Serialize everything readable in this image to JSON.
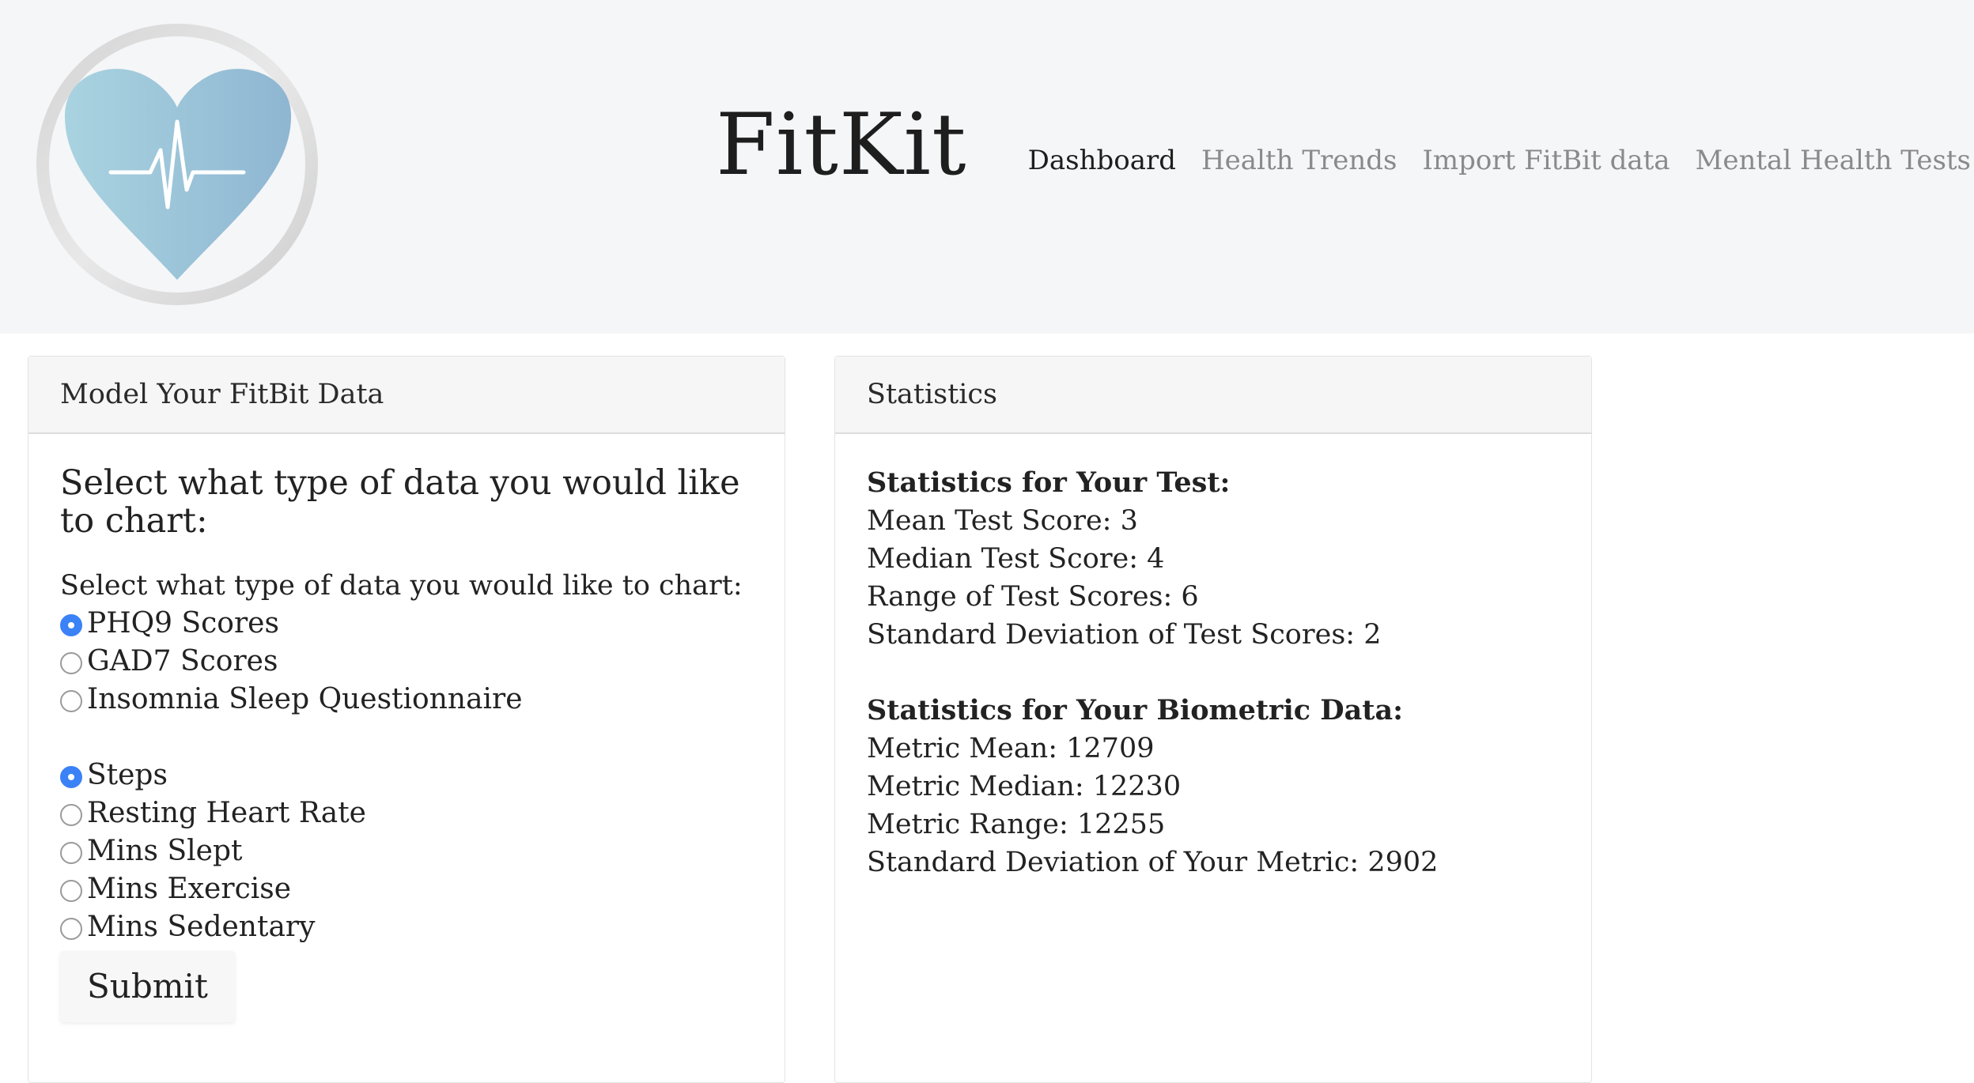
{
  "header": {
    "site_title": "FitKit",
    "logo": "heart-pulse-logo"
  },
  "nav": {
    "items": [
      {
        "label": "Dashboard",
        "active": true
      },
      {
        "label": "Health Trends",
        "active": false
      },
      {
        "label": "Import FitBit data",
        "active": false
      },
      {
        "label": "Mental Health Tests",
        "active": false
      }
    ]
  },
  "model_panel": {
    "heading": "Model Your FitBit Data",
    "form_heading": "Select what type of data you would like to chart:",
    "form_label": "Select what type of data you would like to chart:",
    "test_options": [
      {
        "label": "PHQ9 Scores",
        "checked": true
      },
      {
        "label": "GAD7 Scores",
        "checked": false
      },
      {
        "label": "Insomnia Sleep Questionnaire",
        "checked": false
      }
    ],
    "metric_options": [
      {
        "label": "Steps",
        "checked": true
      },
      {
        "label": "Resting Heart Rate",
        "checked": false
      },
      {
        "label": "Mins Slept",
        "checked": false
      },
      {
        "label": "Mins Exercise",
        "checked": false
      },
      {
        "label": "Mins Sedentary",
        "checked": false
      }
    ],
    "submit_label": "Submit"
  },
  "stats_panel": {
    "heading": "Statistics",
    "test_title": "Statistics for Your Test:",
    "test_stats": [
      "Mean Test Score: 3",
      "Median Test Score: 4",
      "Range of Test Scores: 6",
      "Standard Deviation of Test Scores: 2"
    ],
    "bio_title": "Statistics for Your Biometric Data:",
    "bio_stats": [
      "Metric Mean: 12709",
      "Metric Median: 12230",
      "Metric Range: 12255",
      "Standard Deviation of Your Metric: 2902"
    ]
  },
  "colors": {
    "header_bg": "#f5f6f8",
    "radio_accent": "#3b82f6",
    "heart_light": "#a9d3e0",
    "heart_dark": "#8fb6d2"
  }
}
